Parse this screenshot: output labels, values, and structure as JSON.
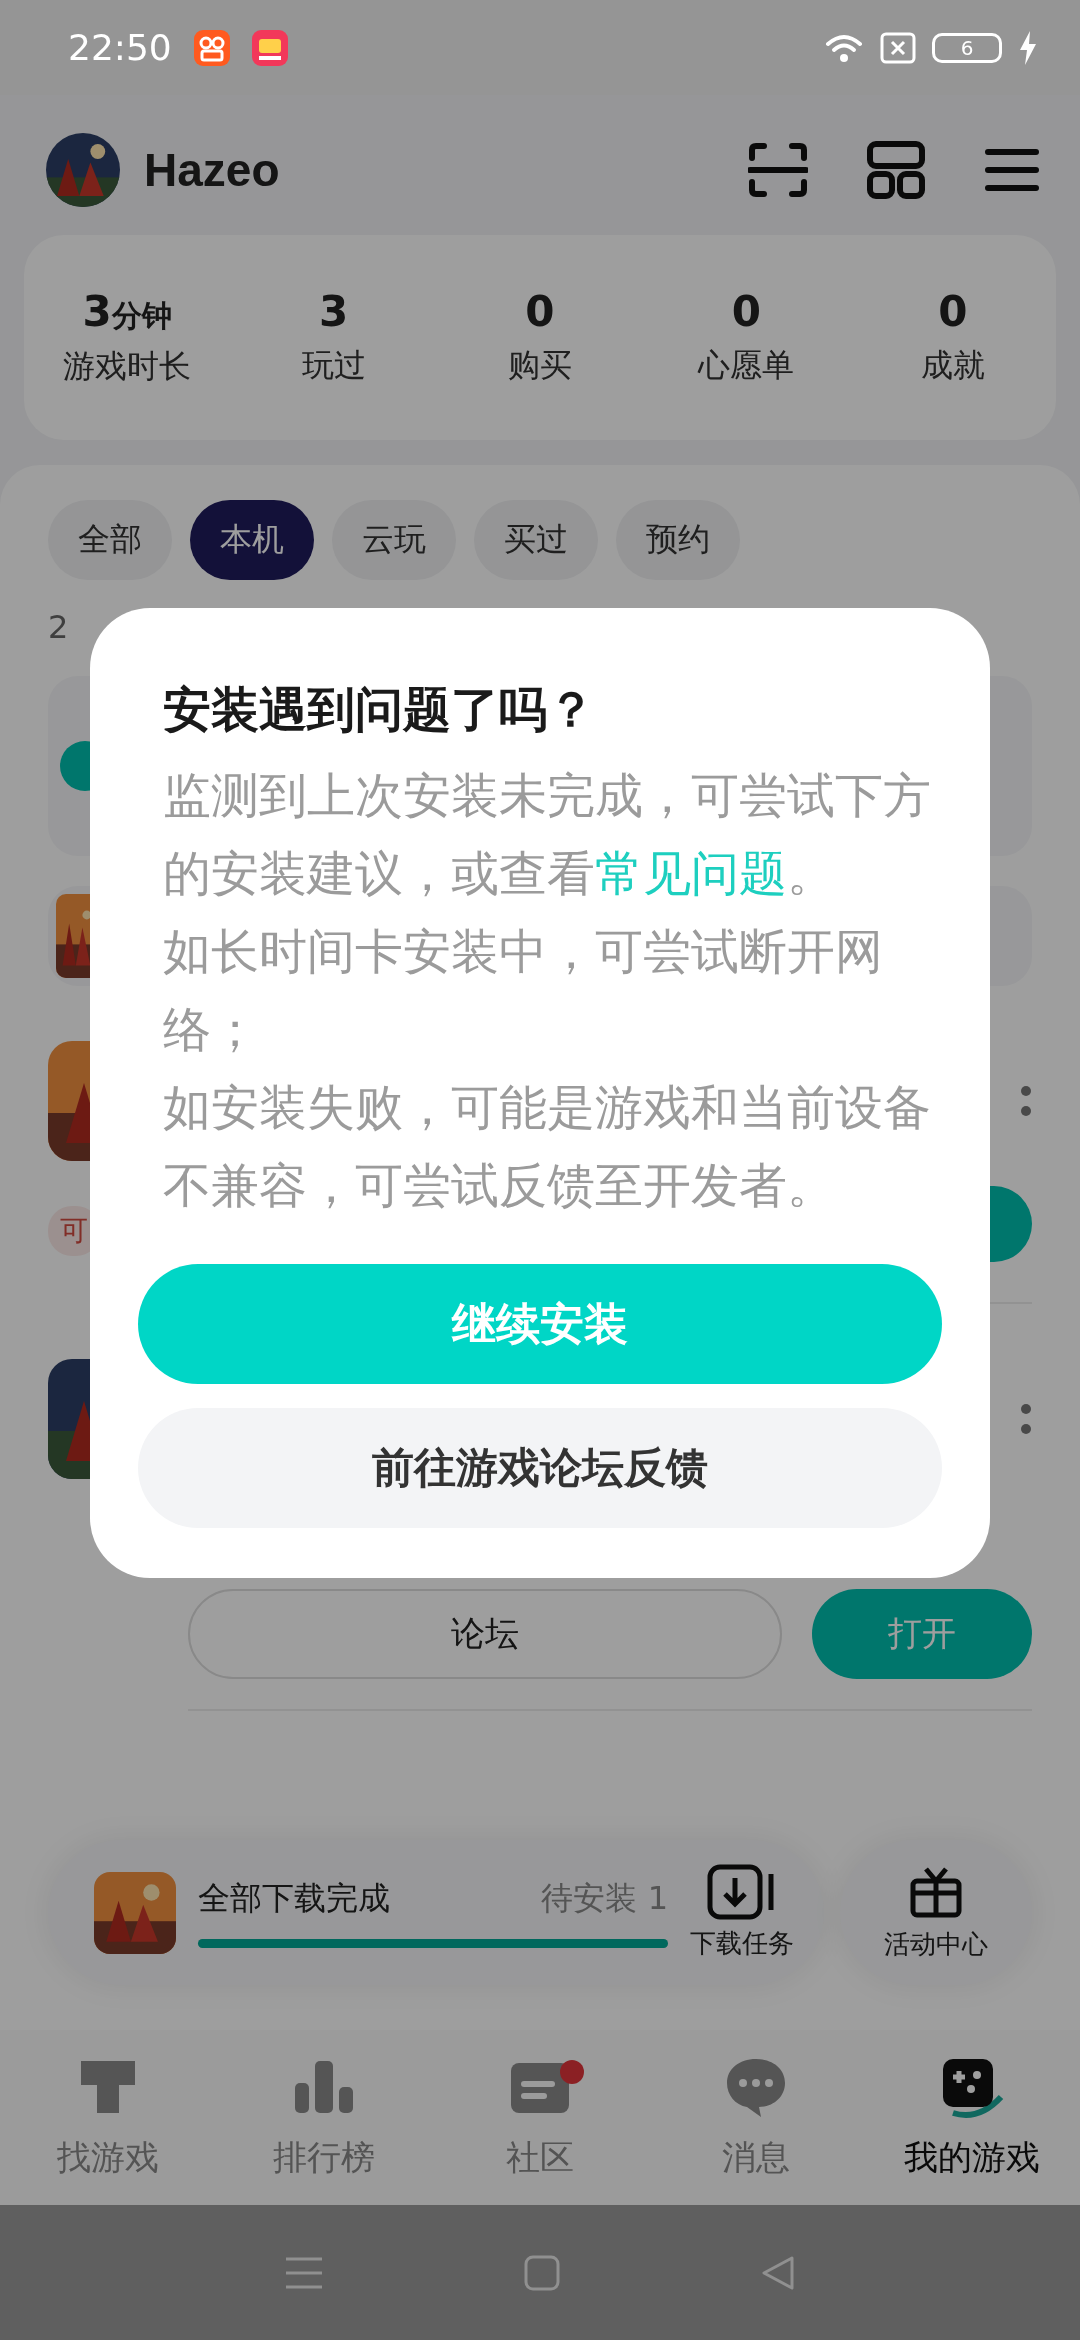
{
  "status_bar": {
    "time": "22:50",
    "battery": "6"
  },
  "header": {
    "username": "Hazeo"
  },
  "stats": [
    {
      "value": "3",
      "unit": "分钟",
      "label": "游戏时长"
    },
    {
      "value": "3",
      "label": "玩过"
    },
    {
      "value": "0",
      "label": "购买"
    },
    {
      "value": "0",
      "label": "心愿单"
    },
    {
      "value": "0",
      "label": "成就"
    }
  ],
  "filters": [
    {
      "label": "全部",
      "selected": false
    },
    {
      "label": "本机",
      "selected": true
    },
    {
      "label": "云玩",
      "selected": false
    },
    {
      "label": "买过",
      "selected": false
    },
    {
      "label": "预约",
      "selected": false
    }
  ],
  "game_count": "2",
  "games": [
    {
      "tag": "可"
    },
    {
      "forum_button": "论坛",
      "open_button": "打开"
    }
  ],
  "dialog": {
    "title": "安装遇到问题了吗？",
    "paragraphs": [
      {
        "text": "监测到上次安装未完成，可尝试下方的安装建议，或查看",
        "link": "常见问题",
        "after": "。"
      },
      {
        "text": "如长时间卡安装中，可尝试断开网络；"
      },
      {
        "text": "如安装失败，可能是游戏和当前设备不兼容，可尝试反馈至开发者。"
      }
    ],
    "primary_button": "继续安装",
    "secondary_button": "前往游戏论坛反馈"
  },
  "download_bar": {
    "title": "全部下载完成",
    "pending": "待安装 1",
    "level": 1.0,
    "tasks_label": "下载任务"
  },
  "activity": {
    "label": "活动中心"
  },
  "tabs": [
    {
      "label": "找游戏",
      "selected": false,
      "badge": false
    },
    {
      "label": "排行榜",
      "selected": false,
      "badge": false
    },
    {
      "label": "社区",
      "selected": false,
      "badge": true
    },
    {
      "label": "消息",
      "selected": false,
      "badge": false
    },
    {
      "label": "我的游戏",
      "selected": true,
      "badge": false
    }
  ]
}
